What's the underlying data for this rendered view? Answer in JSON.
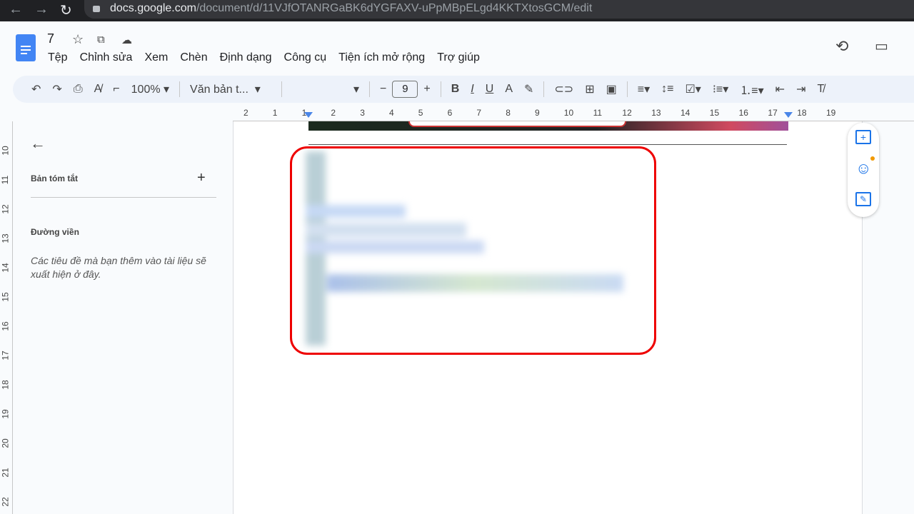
{
  "browser": {
    "url_domain": "docs.google.com",
    "url_path": "/document/d/11VJfOTANRGaBK6dYGFAXV-uPpMBpELgd4KKTXtosGCM/edit"
  },
  "doc": {
    "title": "7"
  },
  "menu": [
    "Tệp",
    "Chỉnh sửa",
    "Xem",
    "Chèn",
    "Định dạng",
    "Công cụ",
    "Tiện ích mở rộng",
    "Trợ giúp"
  ],
  "toolbar": {
    "zoom": "100%",
    "style": "Văn bản t...",
    "font": "",
    "font_size": "9"
  },
  "ruler": {
    "h": [
      "2",
      "1",
      "1",
      "2",
      "3",
      "4",
      "5",
      "6",
      "7",
      "8",
      "9",
      "10",
      "11",
      "12",
      "13",
      "14",
      "15",
      "16",
      "17",
      "18",
      "19"
    ],
    "v": [
      "10",
      "11",
      "12",
      "13",
      "14",
      "15",
      "16",
      "17",
      "18",
      "19",
      "20",
      "21",
      "22"
    ]
  },
  "outline": {
    "summary": "Bản tóm tắt",
    "outline_label": "Đường viền",
    "empty_text": "Các tiêu đề mà bạn thêm vào tài liệu sẽ xuất hiện ở đây."
  },
  "colors": {
    "highlight": "#ee0000",
    "accent": "#1a73e8"
  }
}
